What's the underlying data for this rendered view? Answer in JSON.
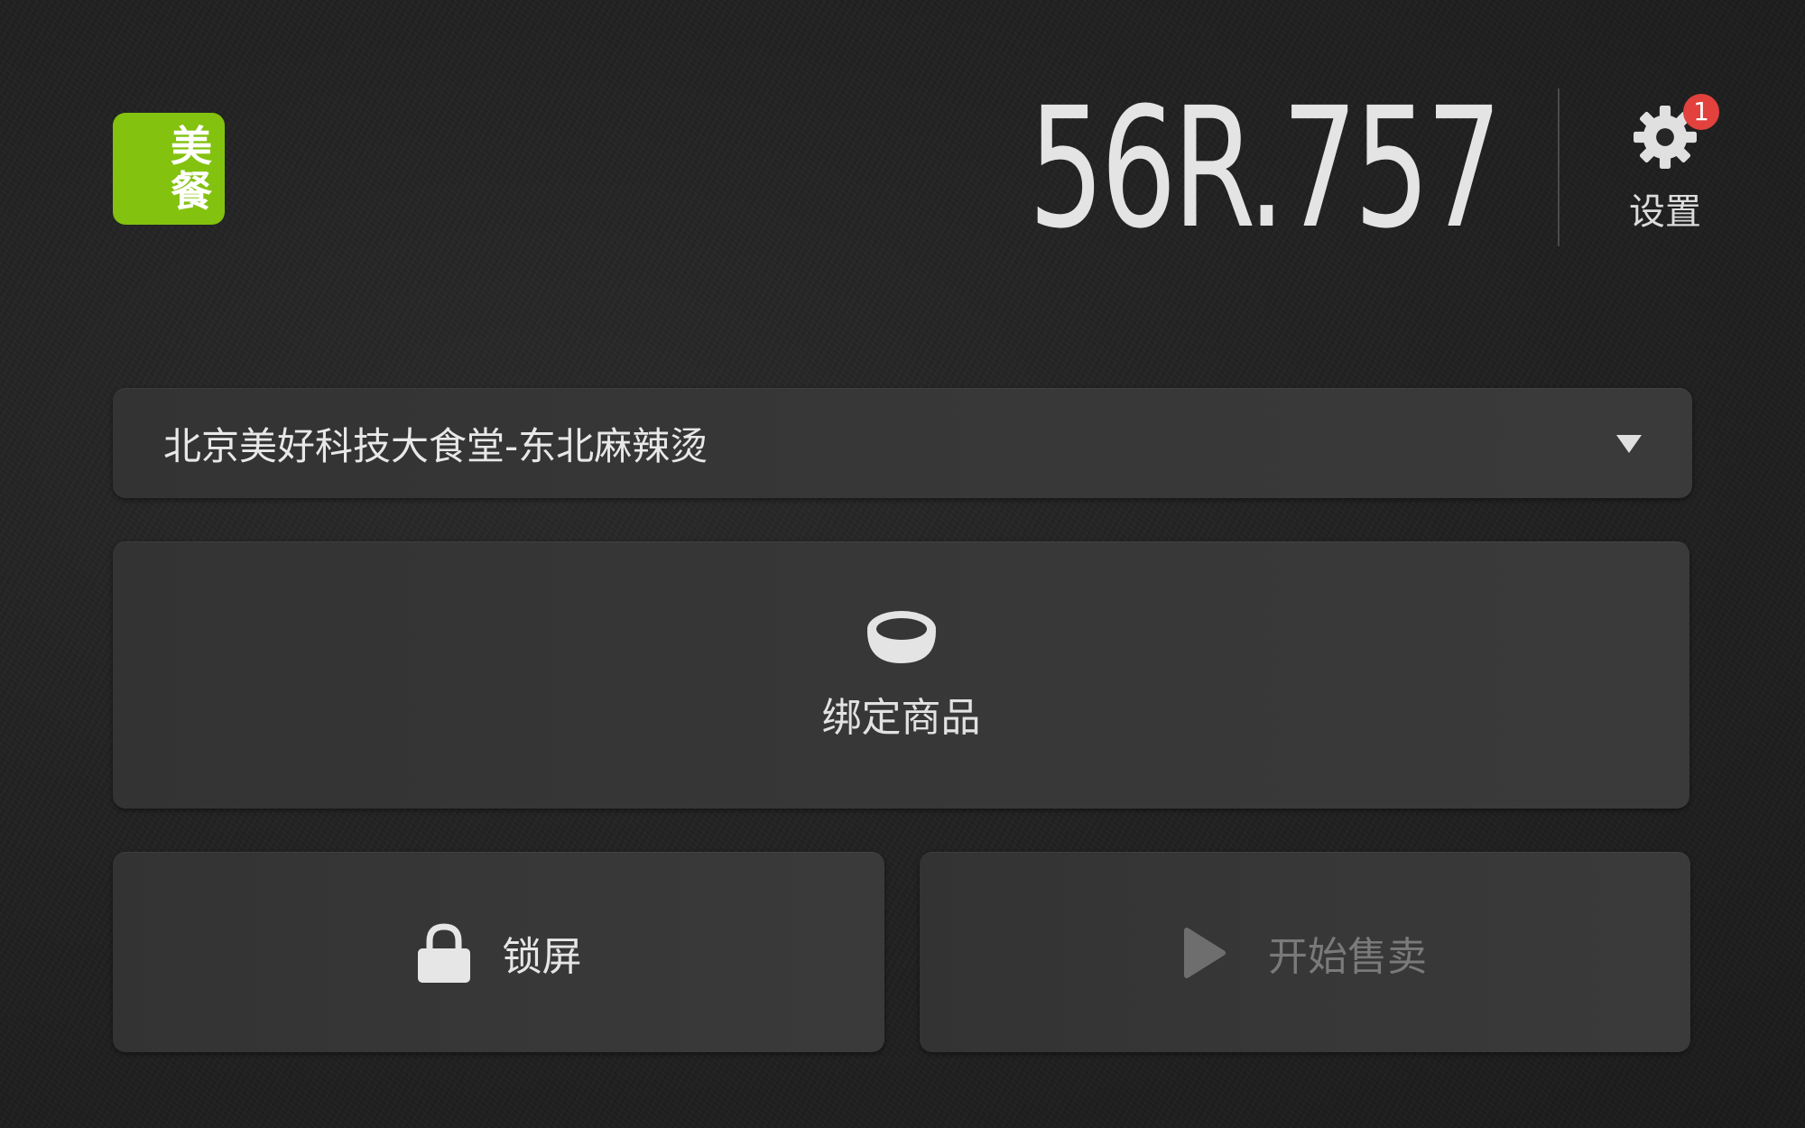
{
  "logo": {
    "line1": "美",
    "line2": "餐",
    "brand_color": "#83c20f"
  },
  "header": {
    "device_code": "56R.757",
    "settings": {
      "label": "设置",
      "badge_count": "1",
      "icon": "gear-icon",
      "badge_color": "#e2413d"
    }
  },
  "store_select": {
    "selected": "北京美好科技大食堂-东北麻辣烫",
    "icon": "caret-down-icon"
  },
  "actions": {
    "bind_products": {
      "label": "绑定商品",
      "icon": "bowl-icon"
    },
    "lock_screen": {
      "label": "锁屏",
      "icon": "lock-icon"
    },
    "start_selling": {
      "label": "开始售卖",
      "icon": "play-icon",
      "enabled": false
    }
  }
}
